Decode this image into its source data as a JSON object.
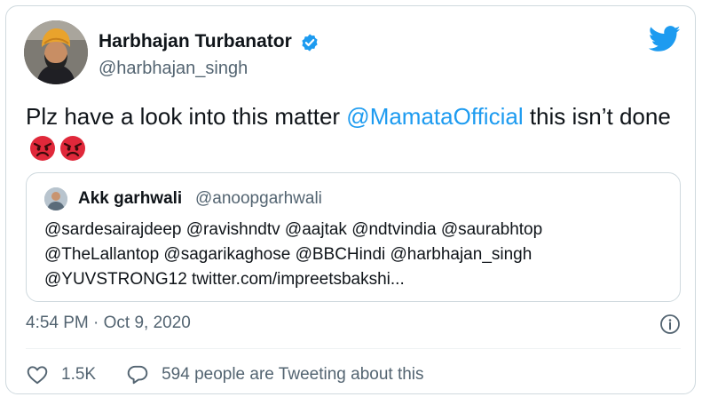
{
  "tweet": {
    "author_name": "Harbhajan Turbanator",
    "handle": "@harbhajan_singh",
    "text_before": "Plz have a look into this matter ",
    "mention": "@MamataOfficial",
    "text_after": " this isn’t done",
    "emojis": [
      "angry-face-emoji",
      "angry-face-emoji"
    ],
    "timestamp": "4:54 PM · Oct 9, 2020",
    "likes": "1.5K",
    "replies_text": "594 people are Tweeting about this"
  },
  "quoted": {
    "author_name": "Akk garhwali",
    "handle": "@anoopgarhwali",
    "lines": [
      "@sardesairajdeep @ravishndtv @aajtak @ndtvindia @saurabhtop",
      "@TheLallantop @sagarikaghose @BBCHindi @harbhajan_singh",
      "@YUVSTRONG12 twitter.com/impreetsbakshi..."
    ]
  },
  "colors": {
    "accent": "#1d9bf0",
    "text": "#0f1419",
    "muted": "#536471",
    "border": "#cfd9de",
    "emoji": "#e0283a"
  },
  "icons": {
    "logo": "twitter-bird-icon",
    "verified": "verified-badge-icon",
    "info": "info-icon",
    "like": "heart-icon",
    "reply": "speech-bubble-icon"
  }
}
